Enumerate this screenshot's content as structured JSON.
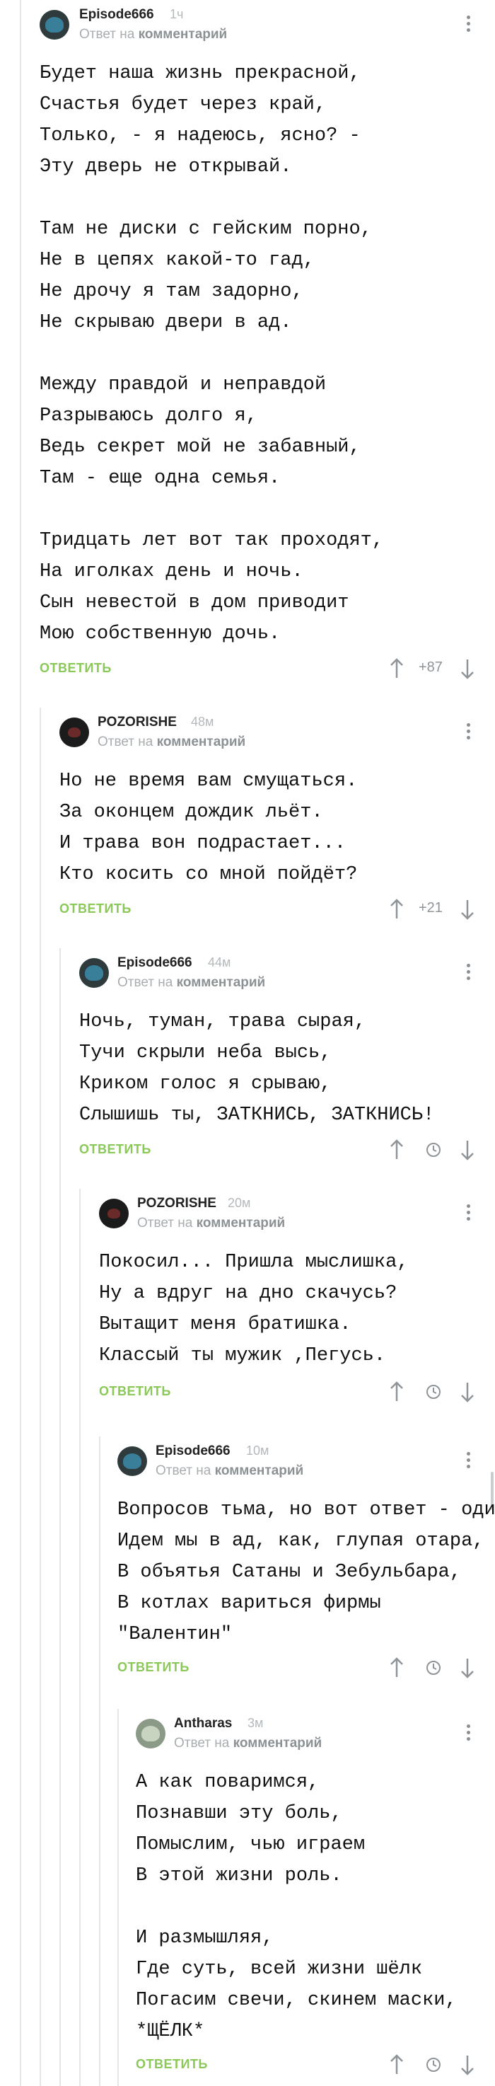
{
  "comments": [
    {
      "author": "Episode666",
      "time": "1ч",
      "reply_prefix": "Ответ на",
      "reply_target": "комментарий",
      "text": "Будет наша жизнь прекрасной,\nСчастья будет через край,\nТолько, - я надеюсь, ясно? -\nЭту дверь не открывай.\n\nТам не диски с гейским порно,\nНе в цепях какой-то гад,\nНе дрочу я там задорно,\nНе скрываю двери в ад.\n\nМежду правдой и неправдой\nРазрываюсь долго я,\nВедь секрет мой не забавный,\nТам - еще одна семья.\n\nТридцать лет вот так проходят,\nНа иголках день и ночь.\nСын невестой в дом приводит\nМою собственную дочь.",
      "reply_label": "ОТВЕТИТЬ",
      "score": "+87"
    },
    {
      "author": "POZORISHE",
      "time": "48м",
      "reply_prefix": "Ответ на",
      "reply_target": "комментарий",
      "text": "Но не время вам смущаться.\nЗа оконцем дождик льёт.\nИ трава вон подрастает...\nКто косить со мной пойдёт?",
      "reply_label": "ОТВЕТИТЬ",
      "score": "+21"
    },
    {
      "author": "Episode666",
      "time": "44м",
      "reply_prefix": "Ответ на",
      "reply_target": "комментарий",
      "text": "Ночь, туман, трава сырая,\nТучи скрыли неба высь,\nКриком голос я срываю,\nСлышишь ты, ЗАТКНИСЬ, ЗАТКНИСЬ!",
      "reply_label": "ОТВЕТИТЬ",
      "score": ""
    },
    {
      "author": "POZORISHE",
      "time": "20м",
      "reply_prefix": "Ответ на",
      "reply_target": "комментарий",
      "text": "Покосил... Пришла мыслишка,\nНу а вдруг на дно скачусь?\nВытащит меня братишка.\nКлассый ты мужик ,Пегусь.",
      "reply_label": "ОТВЕТИТЬ",
      "score": ""
    },
    {
      "author": "Episode666",
      "time": "10м",
      "reply_prefix": "Ответ на",
      "reply_target": "комментарий",
      "text": "Вопросов тьма, но вот ответ - один,\nИдем мы в ад, как, глупая отара,\nВ объятья Сатаны и Зебульбара,\nВ котлах вариться фирмы\n\"Валентин\"",
      "reply_label": "ОТВЕТИТЬ",
      "score": ""
    },
    {
      "author": "Antharas",
      "time": "3м",
      "reply_prefix": "Ответ на",
      "reply_target": "комментарий",
      "text": "А как поваримся,\nПознавши эту боль,\nПомыслим, чью играем\nВ этой жизни роль.\n\nИ размышляя,\nГде суть, всей жизни шёлк\nПогасим свечи, скинем маски,\n*ЩЁЛК*",
      "reply_label": "ОТВЕТИТЬ",
      "score": ""
    }
  ],
  "colors": {
    "accent": "#8ac858",
    "muted": "#a8adb0",
    "thread_line": "#e2e6e8"
  },
  "icons": [
    "kebab-menu-icon",
    "arrow-up-icon",
    "arrow-down-icon",
    "clock-icon"
  ]
}
